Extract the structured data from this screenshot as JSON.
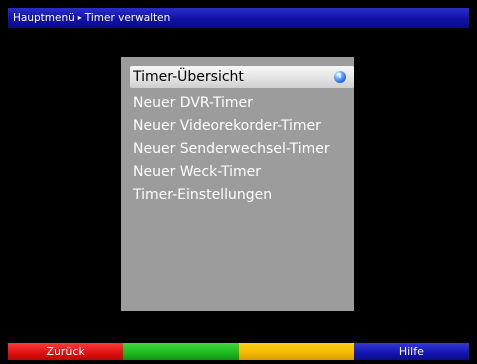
{
  "header": {
    "breadcrumb_parent": "Hauptmenü",
    "breadcrumb_separator": "▸",
    "breadcrumb_current": "Timer verwalten"
  },
  "menu": {
    "items": [
      {
        "label": "Timer-Übersicht",
        "selected": true,
        "icon": "info-icon"
      },
      {
        "label": "Neuer DVR-Timer"
      },
      {
        "label": "Neuer Videorekorder-Timer"
      },
      {
        "label": "Neuer Senderwechsel-Timer"
      },
      {
        "label": "Neuer Weck-Timer"
      },
      {
        "label": "Timer-Einstellungen"
      }
    ]
  },
  "footer": {
    "red_label": "Zurück",
    "green_label": "",
    "yellow_label": "",
    "blue_label": "Hilfe"
  },
  "colors": {
    "background": "#000000",
    "header": "#1010a8",
    "panel": "#9c9c9c",
    "selection": "#e4e4e4",
    "red": "#e01010",
    "green": "#1cb81c",
    "yellow": "#f4b800",
    "blue": "#1515b0"
  }
}
